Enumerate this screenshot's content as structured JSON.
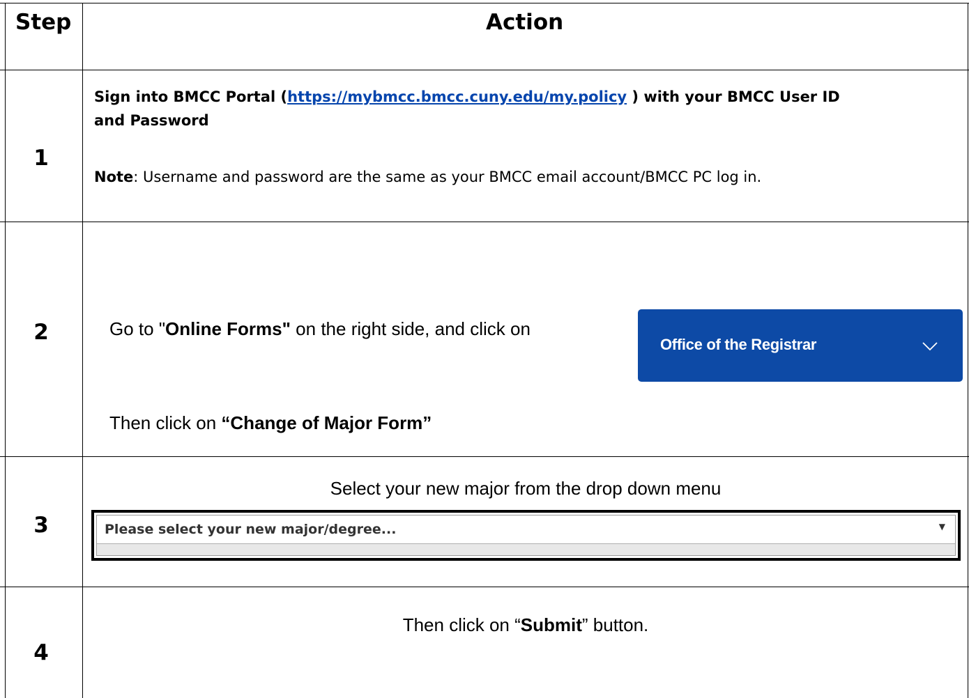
{
  "header": {
    "step": "Step",
    "action": "Action"
  },
  "rows": [
    {
      "step": "1",
      "line1_pre": "Sign into BMCC Portal (",
      "link": "https://mybmcc.bmcc.cuny.edu/my.policy",
      "line1_post": " ) with your BMCC User ID",
      "line2": "and Password",
      "note_label": "Note",
      "note_text": ": Username and password are the same as your BMCC email account/BMCC PC log in."
    },
    {
      "step": "2",
      "goto_pre": "Go to \"",
      "goto_bold": "Online Forms\"",
      "goto_post": " on the right side, and click on",
      "registrar_button": "Office of the Registrar",
      "registrar_icon": "chevron-down-icon",
      "then_pre": "Then click on ",
      "then_bold": "“Change of Major Form”"
    },
    {
      "step": "3",
      "instruction": "Select your new major from the drop down menu",
      "dropdown_value": "Please select your new major/degree...",
      "dropdown_arrow": "▼"
    },
    {
      "step": "4",
      "pre": "Then click on “",
      "bold": "Submit",
      "post": "” button."
    }
  ],
  "colors": {
    "link": "#0645ad",
    "registrar_bg": "#0d4aa6"
  }
}
